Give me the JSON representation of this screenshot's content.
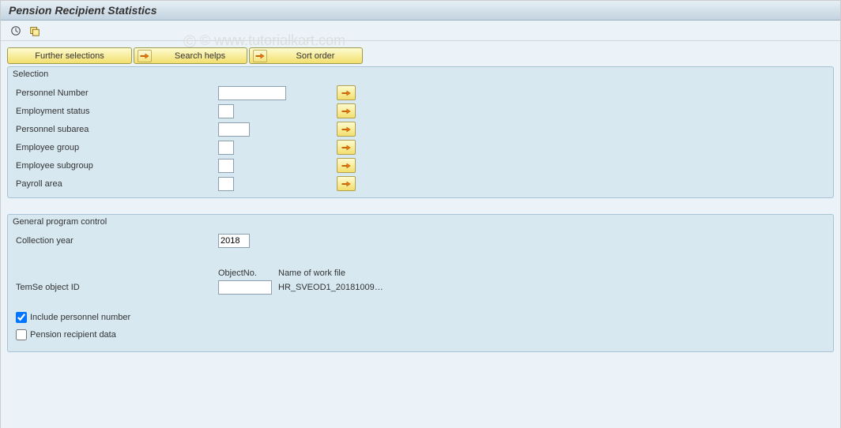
{
  "title": "Pension Recipient Statistics",
  "buttons": {
    "further_selections": "Further selections",
    "search_helps": "Search helps",
    "sort_order": "Sort order"
  },
  "selection": {
    "title": "Selection",
    "rows": [
      {
        "label": "Personnel Number",
        "width": "w-med"
      },
      {
        "label": "Employment status",
        "width": "w-sm"
      },
      {
        "label": "Personnel subarea",
        "width": "w-mid"
      },
      {
        "label": "Employee group",
        "width": "w-sm"
      },
      {
        "label": "Employee subgroup",
        "width": "w-sm"
      },
      {
        "label": "Payroll area",
        "width": "w-sm"
      }
    ]
  },
  "general": {
    "title": "General program control",
    "collection_year_label": "Collection year",
    "collection_year": "2018",
    "object_no": "ObjectNo.",
    "workfile_header": "Name of work file",
    "temse_label": "TemSe object ID",
    "workfile": "HR_SVEOD1_20181009…",
    "include_personnel": "Include personnel number",
    "pension_recipient": "Pension recipient data"
  },
  "watermark": "© www.tutorialkart.com"
}
